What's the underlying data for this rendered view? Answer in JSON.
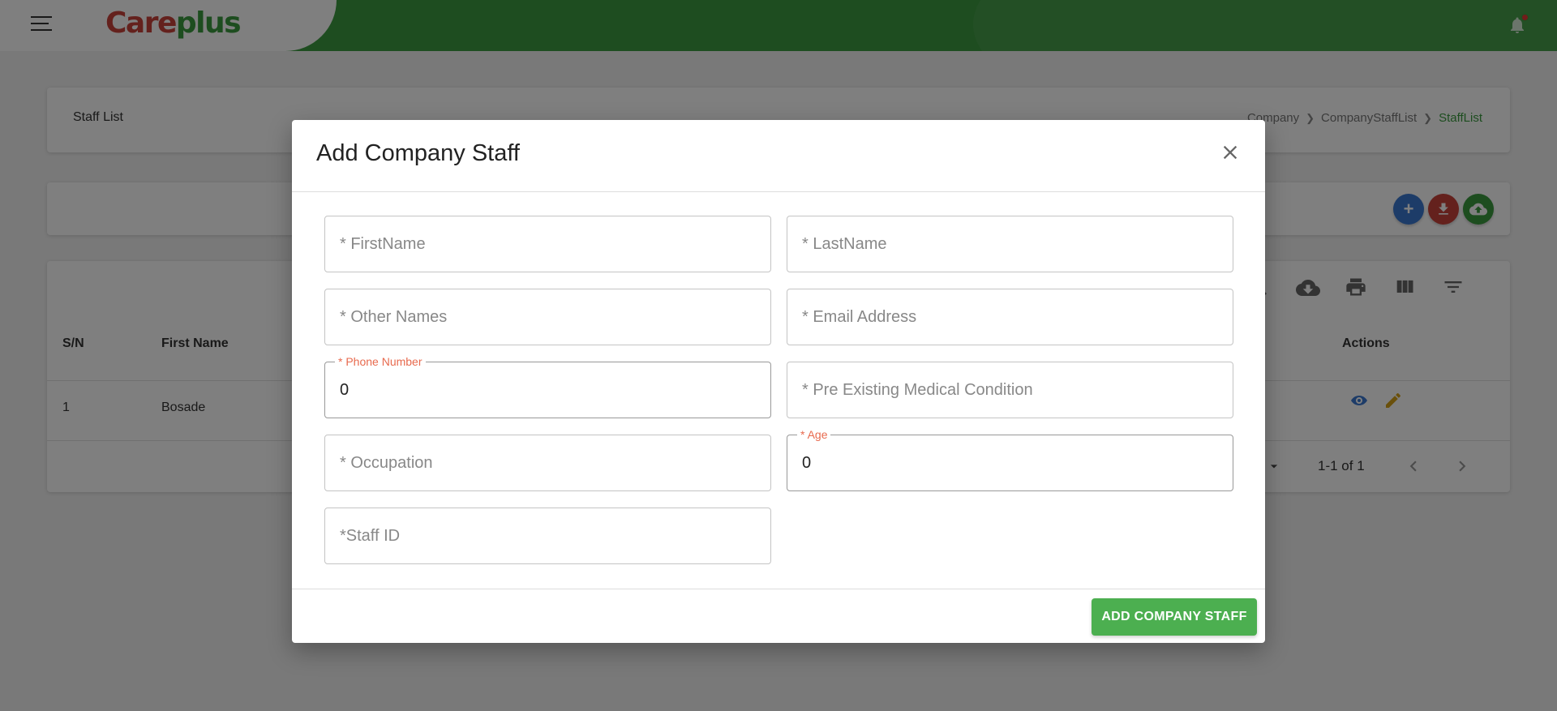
{
  "app": {
    "logo_part1": "Care",
    "logo_part2": "plus"
  },
  "header": {
    "title": "Staff List",
    "breadcrumb": [
      "Company",
      "CompanyStaffList",
      "StaffList"
    ]
  },
  "table": {
    "columns": [
      "S/N",
      "First Name",
      "Actions"
    ],
    "rows": [
      {
        "sn": "1",
        "first_name": "Bosade"
      }
    ],
    "pagination": "1-1 of 1"
  },
  "modal": {
    "title": "Add Company Staff",
    "fields": {
      "first_name": {
        "placeholder": "* FirstName"
      },
      "last_name": {
        "placeholder": "* LastName"
      },
      "other_names": {
        "placeholder": "* Other Names"
      },
      "email": {
        "placeholder": "* Email Address"
      },
      "phone": {
        "label": "* Phone Number",
        "value": "0"
      },
      "medical": {
        "placeholder": "* Pre Existing Medical Condition"
      },
      "occupation": {
        "placeholder": "* Occupation"
      },
      "age": {
        "label": "* Age",
        "value": "0"
      },
      "staff_id": {
        "placeholder": "*Staff ID"
      }
    },
    "submit_label": "ADD COMPANY STAFF"
  },
  "colors": {
    "brand_green": "#3c9a40",
    "button_green": "#4caf50",
    "logo_red": "#c8423a",
    "required_label": "#e86a4e"
  }
}
